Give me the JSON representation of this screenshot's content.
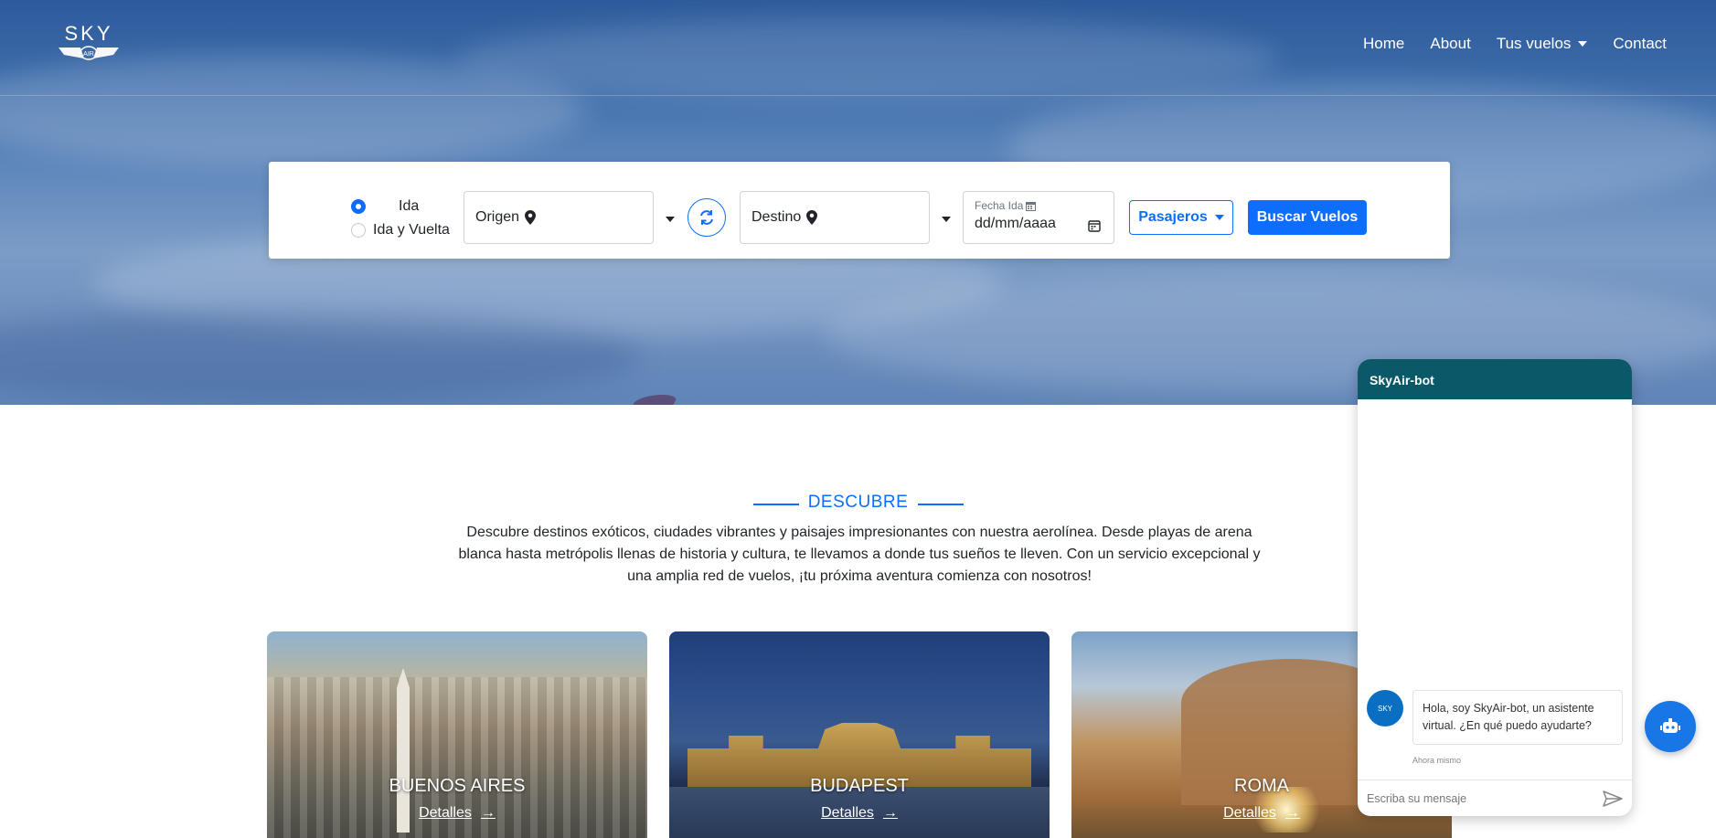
{
  "brand": {
    "logo_text": "SKY",
    "logo_sub": "AIR"
  },
  "nav": {
    "home": "Home",
    "about": "About",
    "flights": "Tus vuelos",
    "contact": "Contact"
  },
  "search": {
    "trip_types": [
      {
        "label": "Ida",
        "selected": true
      },
      {
        "label": "Ida y Vuelta",
        "selected": false
      }
    ],
    "origin_label": "Origen",
    "destination_label": "Destino",
    "date_caption": "Fecha Ida",
    "date_placeholder": "dd/mm/aaaa",
    "passengers_label": "Pasajeros",
    "search_button": "Buscar Vuelos"
  },
  "discover": {
    "title": "DESCUBRE",
    "description": "Descubre destinos exóticos, ciudades vibrantes y paisajes impresionantes con nuestra aerolínea. Desde playas de arena blanca hasta metrópolis llenas de historia y cultura, te llevamos a donde tus sueños te lleven. Con un servicio excepcional y una amplia red de vuelos, ¡tu próxima aventura comienza con nosotros!"
  },
  "destinations": [
    {
      "name": "BUENOS AIRES",
      "link": "Detalles"
    },
    {
      "name": "BUDAPEST",
      "link": "Detalles"
    },
    {
      "name": "ROMA",
      "link": "Detalles"
    }
  ],
  "chat": {
    "title": "SkyAir-bot",
    "avatar_text": "SKY",
    "message": "Hola, soy SkyAir-bot, un asistente virtual. ¿En qué puedo ayudarte?",
    "time": "Ahora mismo",
    "input_placeholder": "Escriba su mensaje"
  },
  "colors": {
    "primary": "#0d6efd",
    "chat_header": "#0b5868",
    "fab": "#1976e6"
  }
}
